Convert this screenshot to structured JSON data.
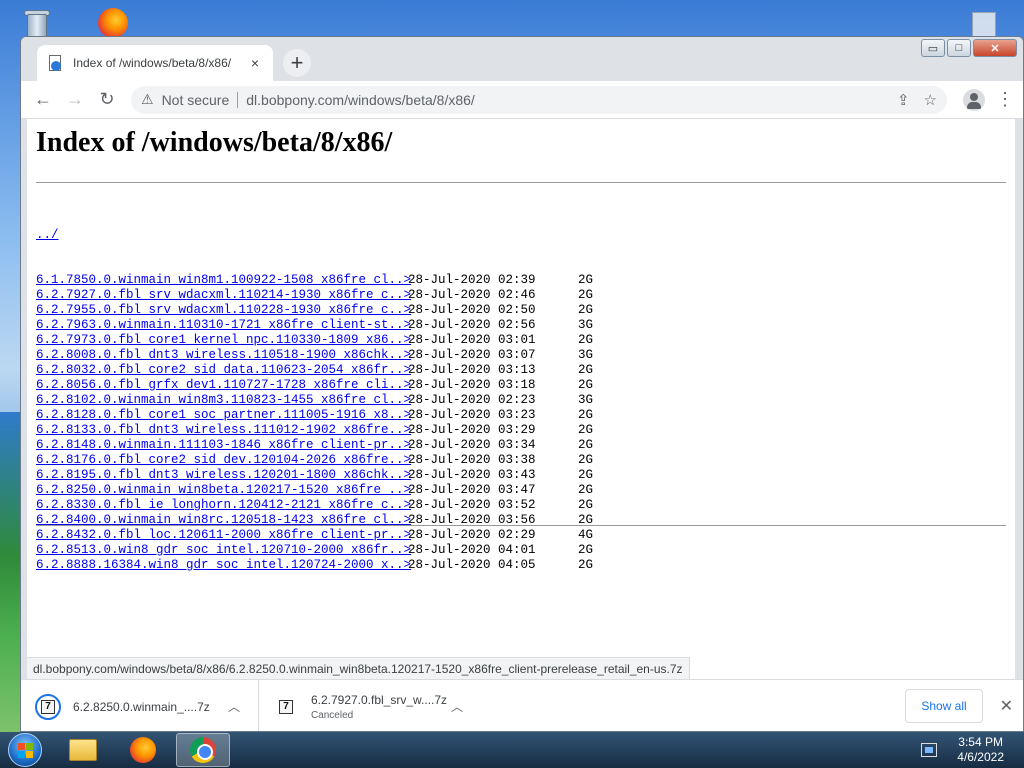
{
  "browser": {
    "tab_title": "Index of /windows/beta/8/x86/",
    "tab_close": "×",
    "new_tab": "+",
    "not_secure": "Not secure",
    "url": "dl.bobpony.com/windows/beta/8/x86/",
    "window_controls": {
      "minimize": "▭",
      "maximize": "□",
      "close": "✕"
    }
  },
  "page": {
    "heading": "Index of /windows/beta/8/x86/",
    "parent_link": "../",
    "entries": [
      {
        "name": "6.1.7850.0.winmain_win8m1.100922-1508_x86fre_cl..>",
        "date": "28-Jul-2020 02:39",
        "size": "2G"
      },
      {
        "name": "6.2.7927.0.fbl_srv_wdacxml.110214-1930_x86fre_c..>",
        "date": "28-Jul-2020 02:46",
        "size": "2G"
      },
      {
        "name": "6.2.7955.0.fbl_srv_wdacxml.110228-1930_x86fre_c..>",
        "date": "28-Jul-2020 02:50",
        "size": "2G"
      },
      {
        "name": "6.2.7963.0.winmain.110310-1721_x86fre_client-st..>",
        "date": "28-Jul-2020 02:56",
        "size": "3G"
      },
      {
        "name": "6.2.7973.0.fbl_core1_kernel_npc.110330-1809_x86..>",
        "date": "28-Jul-2020 03:01",
        "size": "2G"
      },
      {
        "name": "6.2.8008.0.fbl_dnt3_wireless.110518-1900_x86chk..>",
        "date": "28-Jul-2020 03:07",
        "size": "3G"
      },
      {
        "name": "6.2.8032.0.fbl_core2_sid_data.110623-2054_x86fr..>",
        "date": "28-Jul-2020 03:13",
        "size": "2G"
      },
      {
        "name": "6.2.8056.0.fbl_grfx_dev1.110727-1728_x86fre_cli..>",
        "date": "28-Jul-2020 03:18",
        "size": "2G"
      },
      {
        "name": "6.2.8102.0.winmain_win8m3.110823-1455_x86fre_cl..>",
        "date": "28-Jul-2020 02:23",
        "size": "3G"
      },
      {
        "name": "6.2.8128.0.fbl_core1_soc_partner.111005-1916_x8..>",
        "date": "28-Jul-2020 03:23",
        "size": "2G"
      },
      {
        "name": "6.2.8133.0.fbl_dnt3_wireless.111012-1902_x86fre..>",
        "date": "28-Jul-2020 03:29",
        "size": "2G"
      },
      {
        "name": "6.2.8148.0.winmain.111103-1846_x86fre_client-pr..>",
        "date": "28-Jul-2020 03:34",
        "size": "2G"
      },
      {
        "name": "6.2.8176.0.fbl_core2_sid_dev.120104-2026_x86fre..>",
        "date": "28-Jul-2020 03:38",
        "size": "2G"
      },
      {
        "name": "6.2.8195.0.fbl_dnt3_wireless.120201-1800_x86chk..>",
        "date": "28-Jul-2020 03:43",
        "size": "2G"
      },
      {
        "name": "6.2.8250.0.winmain_win8beta.120217-1520_x86fre_..>",
        "date": "28-Jul-2020 03:47",
        "size": "2G"
      },
      {
        "name": "6.2.8330.0.fbl_ie_longhorn.120412-2121_x86fre_c..>",
        "date": "28-Jul-2020 03:52",
        "size": "2G"
      },
      {
        "name": "6.2.8400.0.winmain_win8rc.120518-1423_x86fre_cl..>",
        "date": "28-Jul-2020 03:56",
        "size": "2G"
      },
      {
        "name": "6.2.8432.0.fbl_loc.120611-2000_x86fre_client-pr..>",
        "date": "28-Jul-2020 02:29",
        "size": "4G"
      },
      {
        "name": "6.2.8513.0.win8_gdr_soc_intel.120710-2000_x86fr..>",
        "date": "28-Jul-2020 04:01",
        "size": "2G"
      },
      {
        "name": "6.2.8888.16384.win8_gdr_soc_intel.120724-2000_x..>",
        "date": "28-Jul-2020 04:05",
        "size": "2G"
      }
    ]
  },
  "status_url": "dl.bobpony.com/windows/beta/8/x86/6.2.8250.0.winmain_win8beta.120217-1520_x86fre_client-prerelease_retail_en-us.7z",
  "downloads": {
    "items": [
      {
        "name": "6.2.8250.0.winmain_....7z",
        "status": ""
      },
      {
        "name": "6.2.7927.0.fbl_srv_w....7z",
        "status": "Canceled"
      }
    ],
    "show_all": "Show all",
    "close": "✕"
  },
  "taskbar": {
    "time": "3:54 PM",
    "date": "4/6/2022"
  }
}
